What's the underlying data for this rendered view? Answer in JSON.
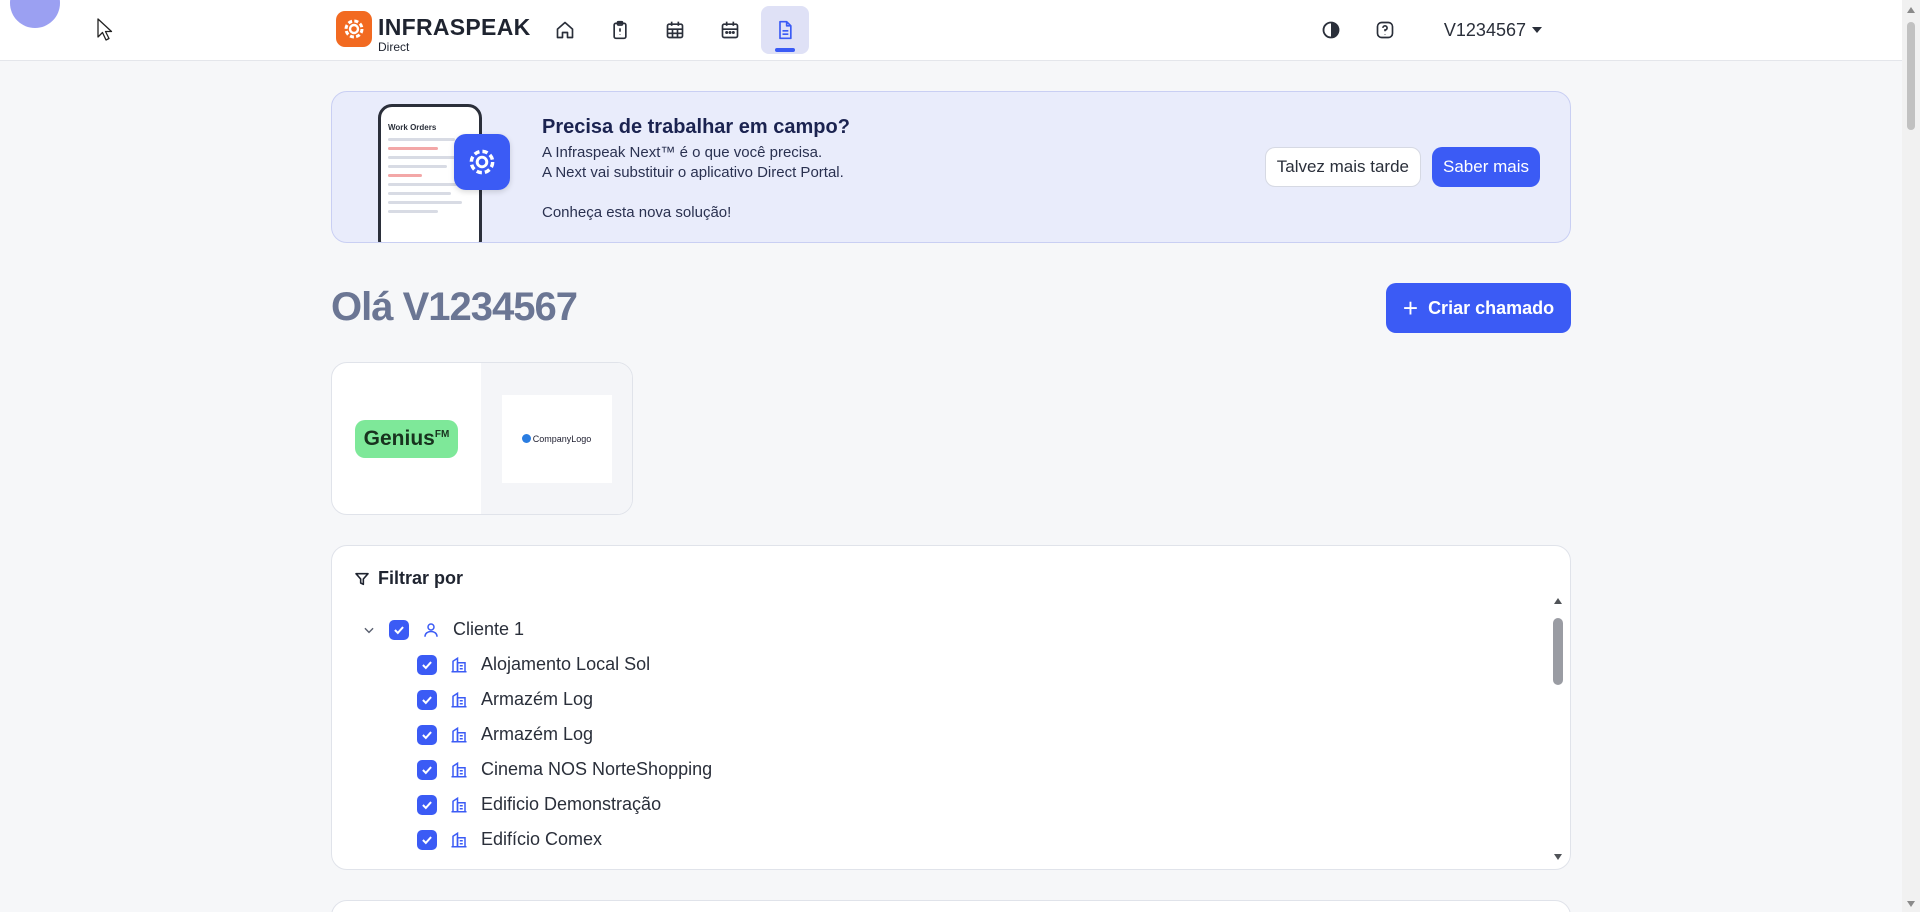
{
  "header": {
    "brand_name": "INFRASPEAK",
    "brand_sub": "Direct",
    "brand_color": "#f26a21",
    "nav": [
      {
        "name": "home-icon",
        "active": false
      },
      {
        "name": "clipboard-alert-icon",
        "active": false
      },
      {
        "name": "calendar-grid-icon",
        "active": false
      },
      {
        "name": "calendar-icon",
        "active": false
      },
      {
        "name": "document-icon",
        "active": true
      }
    ],
    "theme_icon": "contrast-icon",
    "help_icon": "help-icon",
    "user": "V1234567"
  },
  "banner": {
    "phone_title": "Work Orders",
    "title": "Precisa de trabalhar em campo?",
    "line1": "A Infraspeak Next™ é o que você precisa.",
    "line2": "A Next vai substituir o aplicativo Direct Portal.",
    "line3": "Conheça esta nova solução!",
    "later_label": "Talvez mais tarde",
    "learn_label": "Saber mais"
  },
  "greeting": "Olá V1234567",
  "create_label": "Criar chamado",
  "companies": {
    "genius_text": "Genius",
    "genius_sup": "FM",
    "company_logo_text": "CompanyLogo"
  },
  "filter": {
    "title": "Filtrar por",
    "client": "Cliente 1",
    "buildings": [
      "Alojamento Local Sol",
      "Armazém Log",
      "Armazém Log",
      "Cinema NOS NorteShopping",
      "Edificio Demonstração",
      "Edifício Comex"
    ]
  },
  "colors": {
    "primary": "#3b5bf5",
    "banner_bg": "#e9ecfb",
    "genius_green": "#7ee899"
  }
}
